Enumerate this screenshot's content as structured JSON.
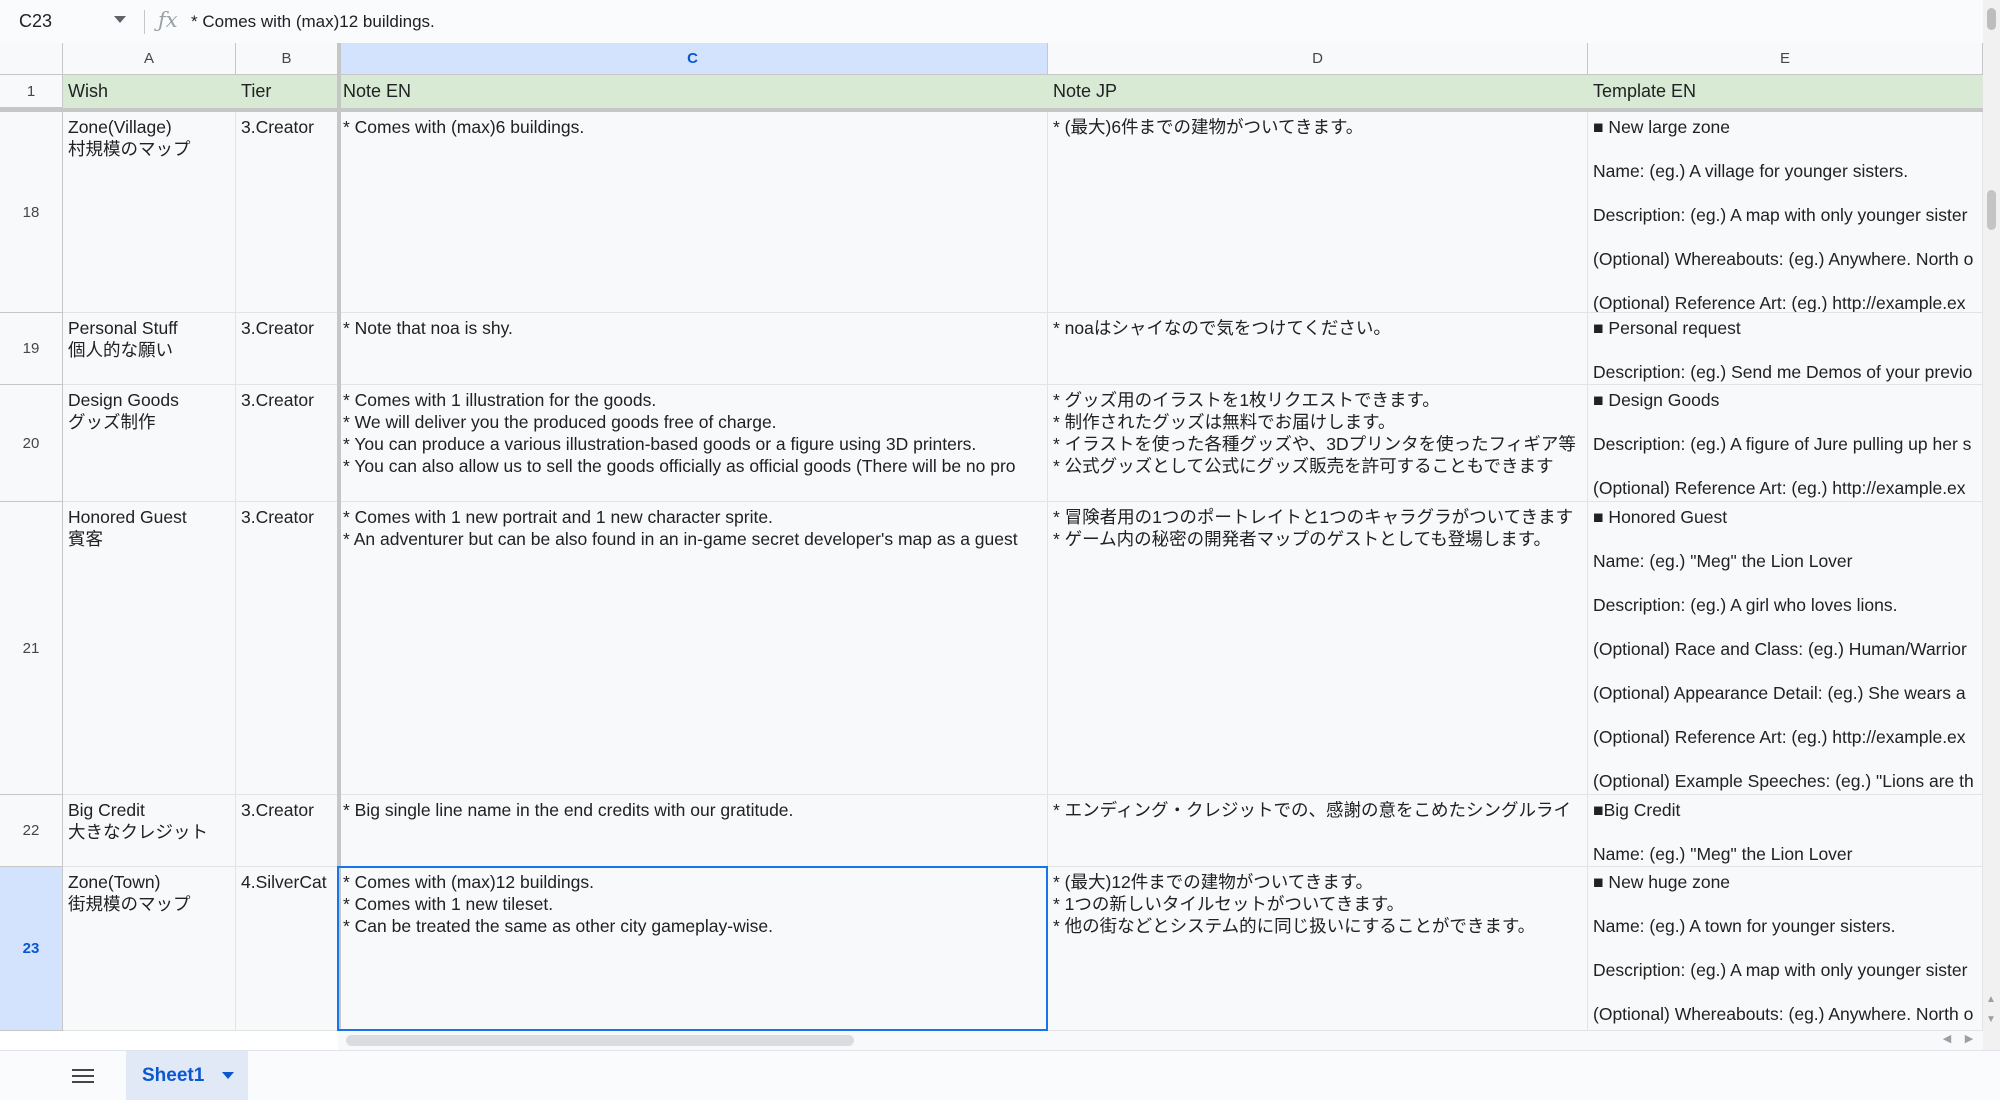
{
  "formula_bar": {
    "cell_ref": "C23",
    "fx_icon": "fx-icon",
    "formula": "* Comes with (max)12 buildings."
  },
  "columns": [
    "A",
    "B",
    "C",
    "D",
    "E"
  ],
  "selected_column": "C",
  "selected_row": "23",
  "header_row": {
    "row_number": "1",
    "cells": [
      "Wish",
      "Tier",
      "Note EN",
      "Note JP",
      "Template EN"
    ]
  },
  "rows": [
    {
      "row_number": "18",
      "wish": [
        "Zone(Village)",
        "村規模のマップ"
      ],
      "tier": "3.Creator",
      "note_en": [
        "* Comes with (max)6 buildings."
      ],
      "note_jp": [
        "* (最大)6件までの建物がついてきます。"
      ],
      "template_en": [
        "■ New large zone",
        "Name: (eg.) A village for younger sisters.",
        "Description: (eg.) A map with only younger sister",
        "(Optional) Whereabouts: (eg.) Anywhere. North o",
        "(Optional) Reference Art: (eg.) http://example.ex"
      ]
    },
    {
      "row_number": "19",
      "wish": [
        "Personal Stuff",
        "個人的な願い"
      ],
      "tier": "3.Creator",
      "note_en": [
        "* Note that noa is shy."
      ],
      "note_jp": [
        "* noaはシャイなので気をつけてください。"
      ],
      "template_en": [
        "■ Personal request",
        "Description: (eg.) Send me Demos of your previo"
      ]
    },
    {
      "row_number": "20",
      "wish": [
        "Design Goods",
        "グッズ制作"
      ],
      "tier": "3.Creator",
      "note_en": [
        "* Comes with 1 illustration for the goods.",
        "* We will deliver you the produced goods free of charge.",
        "* You can produce a various illustration-based goods or a figure using 3D printers.",
        "* You can also allow us to sell the goods officially as official goods (There will be no pro"
      ],
      "note_jp": [
        "* グッズ用のイラストを1枚リクエストできます。",
        "* 制作されたグッズは無料でお届けします。",
        "* イラストを使った各種グッズや、3Dプリンタを使ったフィギア等",
        "* 公式グッズとして公式にグッズ販売を許可することもできます"
      ],
      "template_en": [
        "■ Design Goods",
        "Description: (eg.) A figure of Jure pulling up her s",
        "(Optional) Reference Art: (eg.) http://example.ex"
      ]
    },
    {
      "row_number": "21",
      "wish": [
        "Honored Guest",
        "賓客"
      ],
      "tier": "3.Creator",
      "note_en": [
        "* Comes with 1 new portrait and 1 new character sprite.",
        "* An adventurer but can be also found in an in-game secret developer's map as a guest"
      ],
      "note_jp": [
        "* 冒険者用の1つのポートレイトと1つのキャラグラがついてきます",
        "* ゲーム内の秘密の開発者マップのゲストとしても登場します。"
      ],
      "template_en": [
        "■ Honored Guest",
        "Name: (eg.) \"Meg\" the Lion Lover",
        "Description: (eg.) A girl who loves lions.",
        "(Optional) Race and Class: (eg.) Human/Warrior",
        "(Optional) Appearance Detail: (eg.) She wears a",
        "(Optional) Reference Art: (eg.) http://example.ex",
        "(Optional) Example Speeches: (eg.) \"Lions are th"
      ]
    },
    {
      "row_number": "22",
      "wish": [
        "Big Credit",
        "大きなクレジット"
      ],
      "tier": "3.Creator",
      "note_en": [
        "* Big single line name in the end credits with our gratitude."
      ],
      "note_jp": [
        "* エンディング・クレジットでの、感謝の意をこめたシングルライ"
      ],
      "template_en": [
        "■Big Credit",
        "Name: (eg.) \"Meg\" the Lion Lover"
      ]
    },
    {
      "row_number": "23",
      "wish": [
        "Zone(Town)",
        "街規模のマップ"
      ],
      "tier": "4.SilverCat",
      "note_en": [
        "* Comes with (max)12 buildings.",
        "* Comes with 1 new tileset.",
        "* Can be treated the same as other city gameplay-wise."
      ],
      "note_jp": [
        "* (最大)12件までの建物がついてきます。",
        "* 1つの新しいタイルセットがついてきます。",
        "* 他の街などとシステム的に同じ扱いにすることができます。"
      ],
      "template_en": [
        "■ New huge zone",
        "Name: (eg.) A town for younger sisters.",
        "Description: (eg.) A map with only younger sister",
        "(Optional) Whereabouts: (eg.) Anywhere. North o"
      ]
    }
  ],
  "sheet_bar": {
    "menu_icon": "all-sheets-menu-icon",
    "active_sheet": "Sheet1"
  },
  "colors": {
    "header_fill": "#d8ead3",
    "selection": "#1a73e8",
    "selected_header": "#d3e3fd"
  }
}
